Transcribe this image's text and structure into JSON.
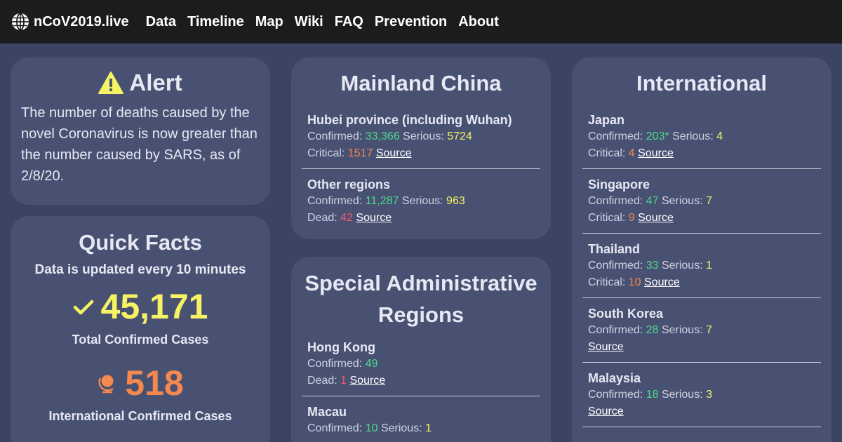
{
  "nav": {
    "brand": "nCoV2019.live",
    "links": [
      "Data",
      "Timeline",
      "Map",
      "Wiki",
      "FAQ",
      "Prevention",
      "About"
    ]
  },
  "alert": {
    "title": "Alert",
    "text": "The number of deaths caused by the novel Coronavirus is now greater than the number caused by SARS, as of 2/8/20."
  },
  "facts": {
    "title": "Quick Facts",
    "subtitle": "Data is updated every 10 minutes",
    "total_value": "45,171",
    "total_label": "Total Confirmed Cases",
    "intl_value": "518",
    "intl_label": "International Confirmed Cases"
  },
  "labels": {
    "confirmed": "Confirmed: ",
    "serious": " Serious: ",
    "critical": "Critical: ",
    "dead": "Dead: ",
    "source": "Source"
  },
  "china": {
    "title": "Mainland China",
    "entries": [
      {
        "name": "Hubei province (including Wuhan)",
        "confirmed": "33,366",
        "serious": "5724",
        "critical": "1517"
      },
      {
        "name": "Other regions",
        "confirmed": "11,287",
        "serious": "963",
        "dead": "42"
      }
    ]
  },
  "sar": {
    "title": "Special Administrative Regions",
    "entries": [
      {
        "name": "Hong Kong",
        "confirmed": "49",
        "dead": "1"
      },
      {
        "name": "Macau",
        "confirmed": "10",
        "serious": "1"
      }
    ]
  },
  "international": {
    "title": "International",
    "entries": [
      {
        "name": "Japan",
        "confirmed": "203*",
        "serious": "4",
        "critical": "4"
      },
      {
        "name": "Singapore",
        "confirmed": "47",
        "serious": "7",
        "critical": "9"
      },
      {
        "name": "Thailand",
        "confirmed": "33",
        "serious": "1",
        "critical": "10"
      },
      {
        "name": "South Korea",
        "confirmed": "28",
        "serious": "7"
      },
      {
        "name": "Malaysia",
        "confirmed": "18",
        "serious": "3"
      }
    ]
  },
  "colors": {
    "background": "#3c4466",
    "card": "#495173",
    "navbar": "#1c1c1c",
    "confirmed": "#4cd98a",
    "serious": "#f5f263",
    "critical": "#f5884e",
    "dead": "#f05a6a"
  },
  "icons": {
    "brand": "globe-icon",
    "alert": "warning-icon",
    "total": "check-icon",
    "international": "globe-stand-icon"
  }
}
